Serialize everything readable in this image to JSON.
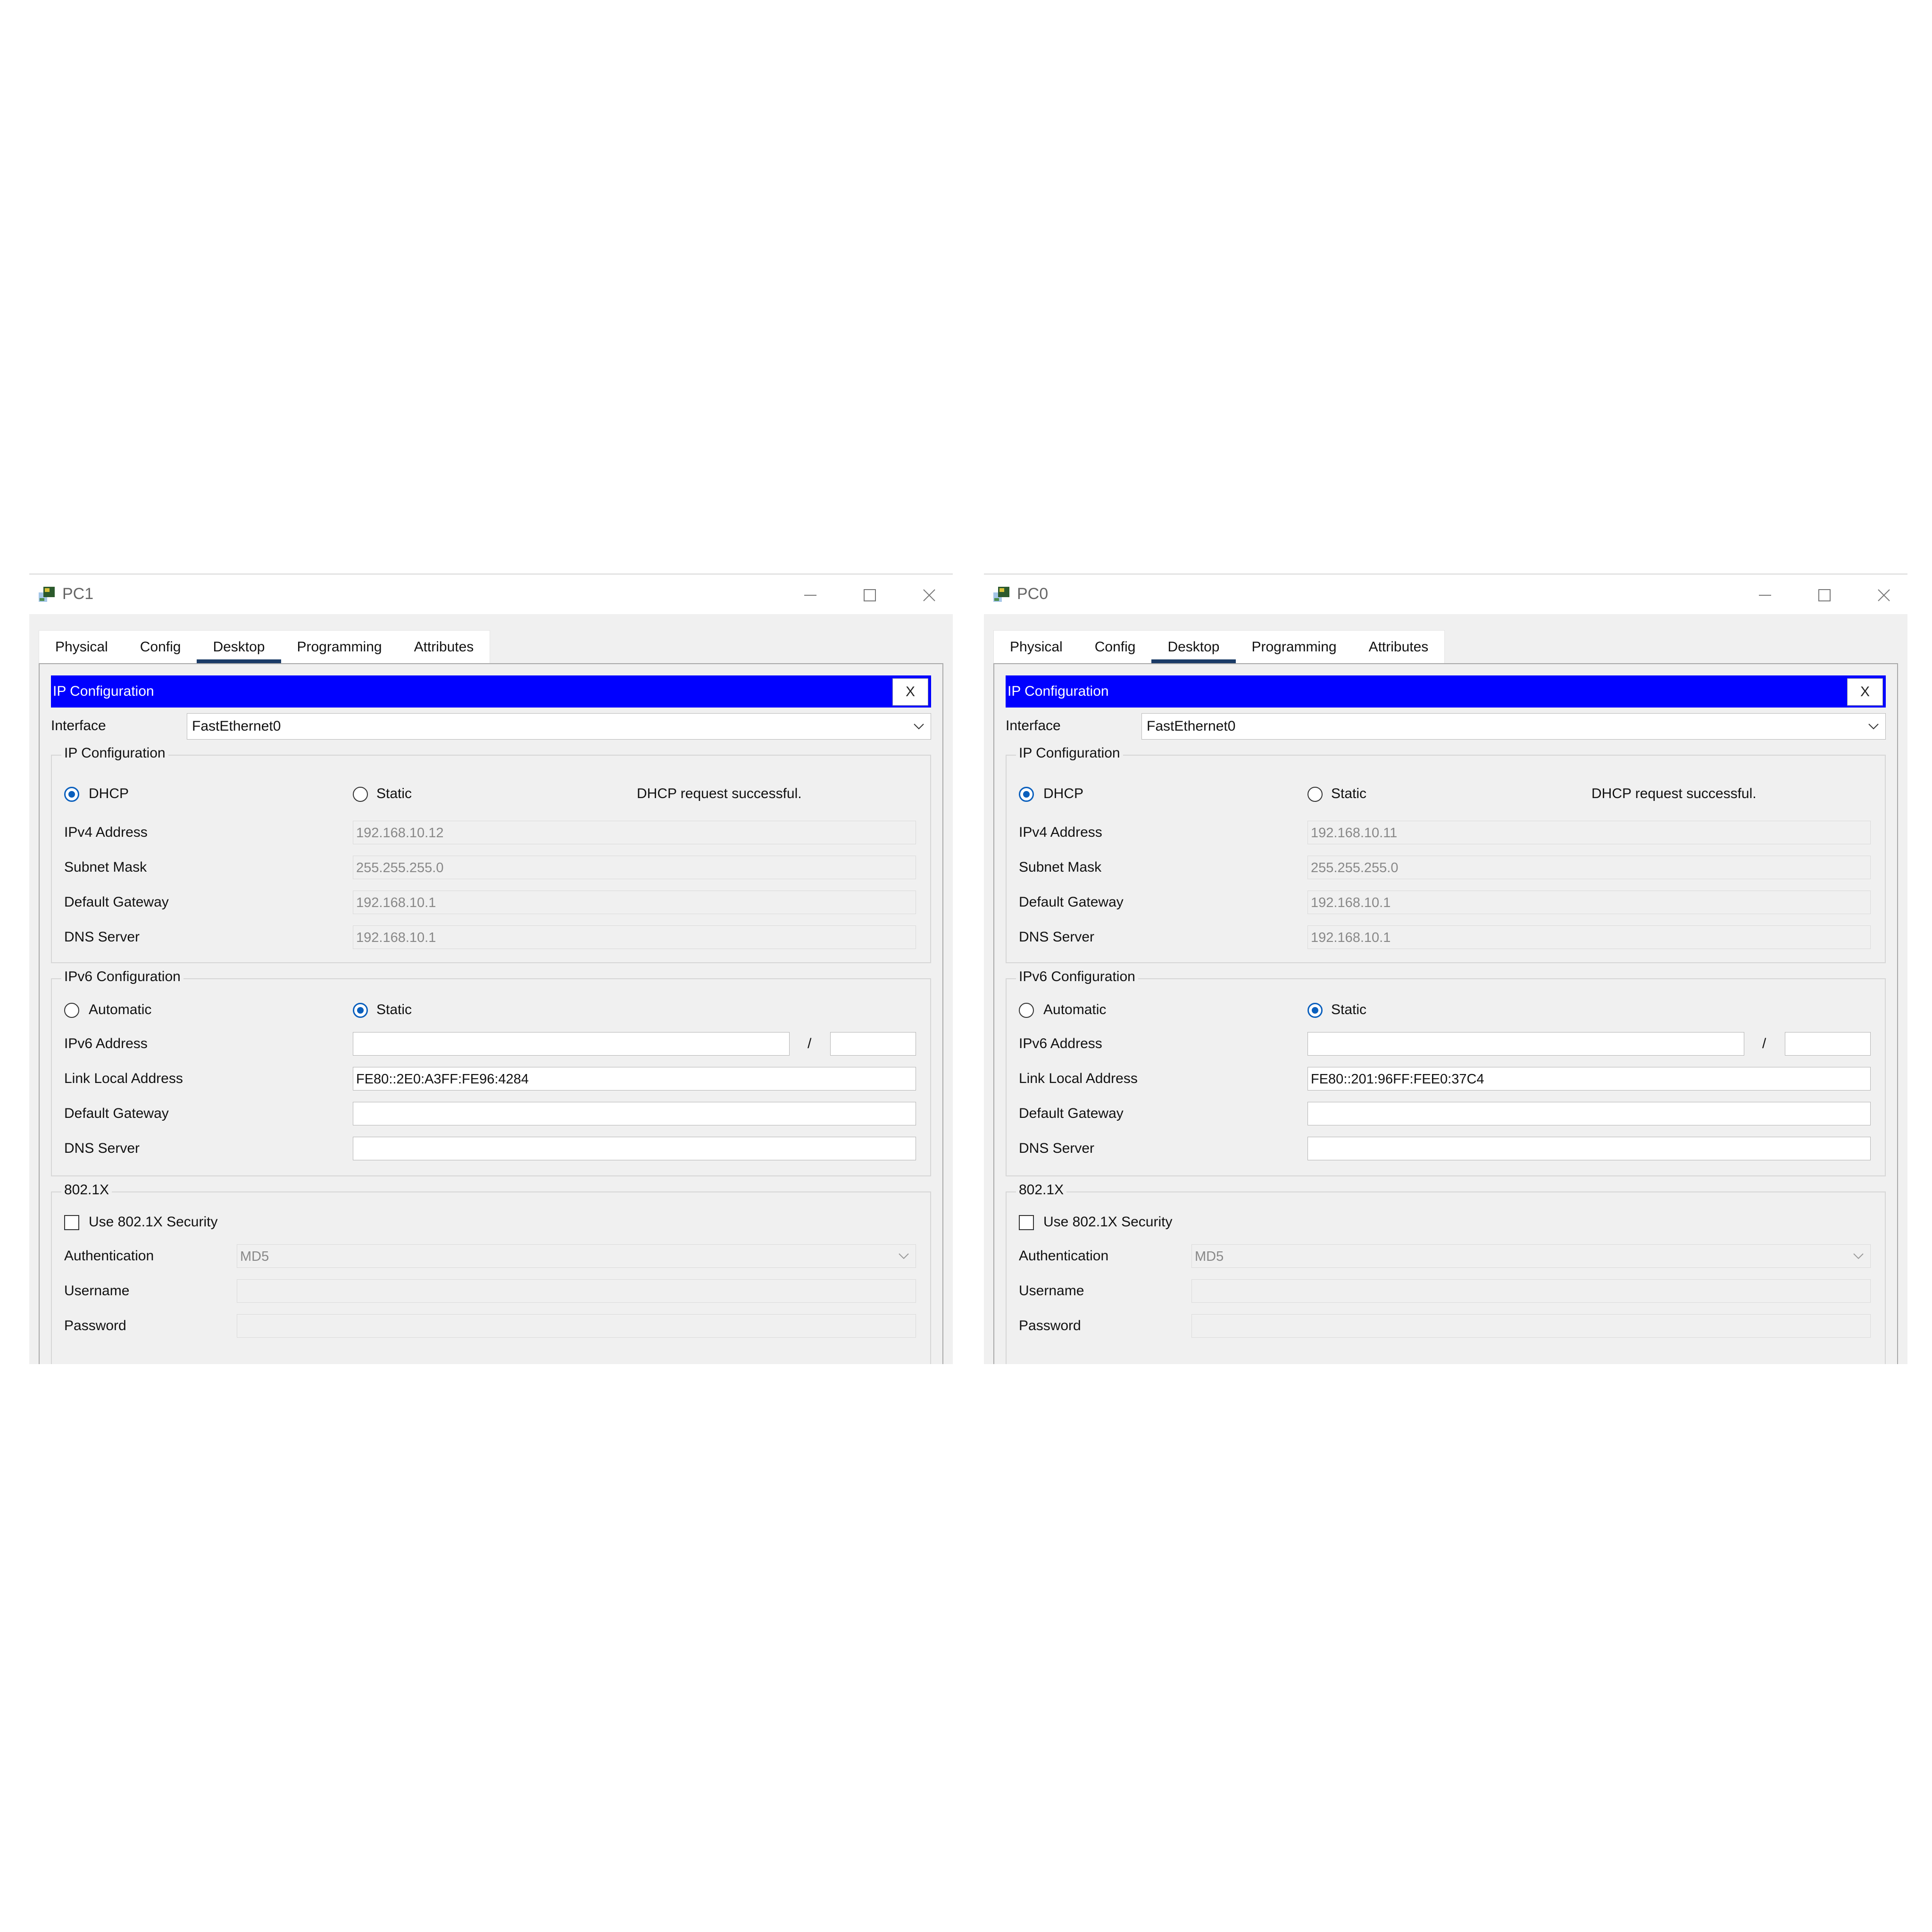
{
  "windows": [
    {
      "title": "PC1",
      "tabs": [
        "Physical",
        "Config",
        "Desktop",
        "Programming",
        "Attributes"
      ],
      "active_tab": "Desktop",
      "panel_title": "IP Configuration",
      "close_label": "X",
      "interface_label": "Interface",
      "interface_value": "FastEthernet0",
      "ipv4": {
        "group_title": "IP Configuration",
        "mode_dhcp": "DHCP",
        "mode_static": "Static",
        "selected_mode": "DHCP",
        "status": "DHCP request successful.",
        "ipv4_address_label": "IPv4 Address",
        "ipv4_address": "192.168.10.12",
        "subnet_mask_label": "Subnet Mask",
        "subnet_mask": "255.255.255.0",
        "default_gateway_label": "Default Gateway",
        "default_gateway": "192.168.10.1",
        "dns_server_label": "DNS Server",
        "dns_server": "192.168.10.1"
      },
      "ipv6": {
        "group_title": "IPv6 Configuration",
        "mode_automatic": "Automatic",
        "mode_static": "Static",
        "selected_mode": "Static",
        "ipv6_address_label": "IPv6 Address",
        "ipv6_address": "",
        "prefix_separator": "/",
        "prefix_length": "",
        "link_local_label": "Link Local Address",
        "link_local": "FE80::2E0:A3FF:FE96:4284",
        "default_gateway_label": "Default Gateway",
        "default_gateway": "",
        "dns_server_label": "DNS Server",
        "dns_server": ""
      },
      "dot1x": {
        "group_title": "802.1X",
        "use_security_label": "Use 802.1X Security",
        "use_security_checked": false,
        "authentication_label": "Authentication",
        "authentication": "MD5",
        "username_label": "Username",
        "username": "",
        "password_label": "Password",
        "password": ""
      }
    },
    {
      "title": "PC0",
      "tabs": [
        "Physical",
        "Config",
        "Desktop",
        "Programming",
        "Attributes"
      ],
      "active_tab": "Desktop",
      "panel_title": "IP Configuration",
      "close_label": "X",
      "interface_label": "Interface",
      "interface_value": "FastEthernet0",
      "ipv4": {
        "group_title": "IP Configuration",
        "mode_dhcp": "DHCP",
        "mode_static": "Static",
        "selected_mode": "DHCP",
        "status": "DHCP request successful.",
        "ipv4_address_label": "IPv4 Address",
        "ipv4_address": "192.168.10.11",
        "subnet_mask_label": "Subnet Mask",
        "subnet_mask": "255.255.255.0",
        "default_gateway_label": "Default Gateway",
        "default_gateway": "192.168.10.1",
        "dns_server_label": "DNS Server",
        "dns_server": "192.168.10.1"
      },
      "ipv6": {
        "group_title": "IPv6 Configuration",
        "mode_automatic": "Automatic",
        "mode_static": "Static",
        "selected_mode": "Static",
        "ipv6_address_label": "IPv6 Address",
        "ipv6_address": "",
        "prefix_separator": "/",
        "prefix_length": "",
        "link_local_label": "Link Local Address",
        "link_local": "FE80::201:96FF:FEE0:37C4",
        "default_gateway_label": "Default Gateway",
        "default_gateway": "",
        "dns_server_label": "DNS Server",
        "dns_server": ""
      },
      "dot1x": {
        "group_title": "802.1X",
        "use_security_label": "Use 802.1X Security",
        "use_security_checked": false,
        "authentication_label": "Authentication",
        "authentication": "MD5",
        "username_label": "Username",
        "username": "",
        "password_label": "Password",
        "password": ""
      }
    }
  ],
  "icons": [
    "packet-tracer-pc-icon",
    "minimize-icon",
    "maximize-icon",
    "close-icon",
    "chevron-down-icon"
  ],
  "colors": {
    "header_bar": "#0000ff",
    "active_tab_underline": "#1a3a66",
    "radio_selected": "#0a5fbd",
    "panel_background": "#f0f0f0"
  }
}
